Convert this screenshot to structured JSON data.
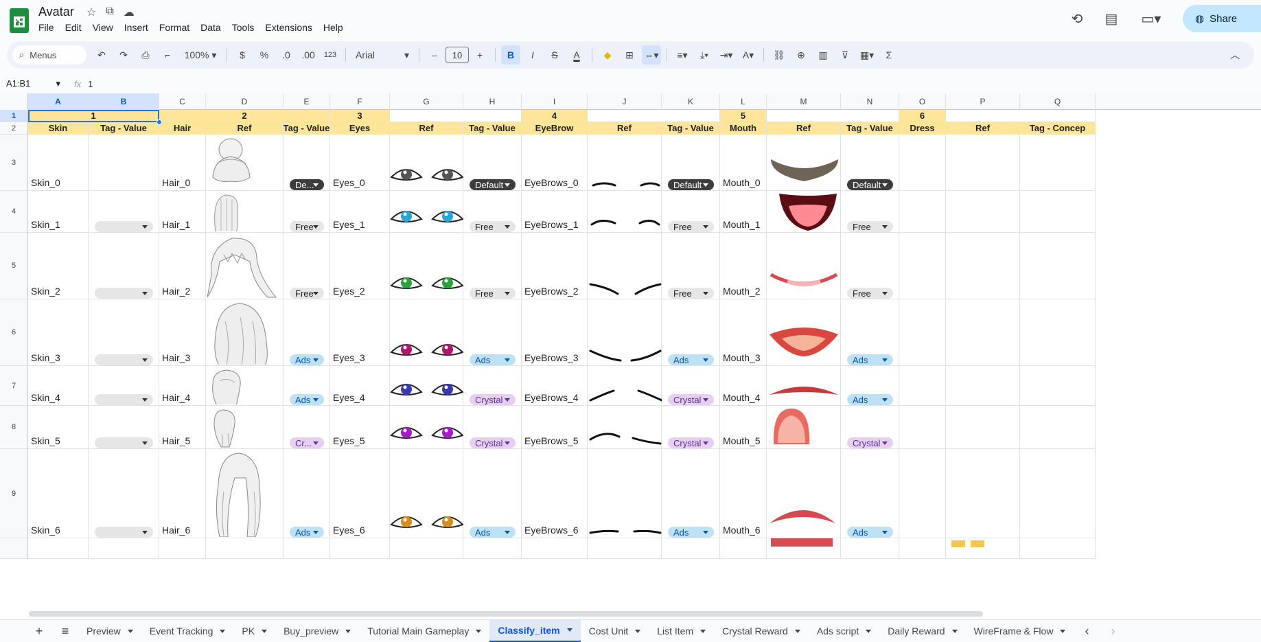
{
  "doc": {
    "title": "Avatar",
    "icons": [
      "star-icon",
      "move-to-folder-icon",
      "cloud-saved-icon"
    ]
  },
  "menu": [
    "File",
    "Edit",
    "View",
    "Insert",
    "Format",
    "Data",
    "Tools",
    "Extensions",
    "Help"
  ],
  "header_right": {
    "share_label": "Share",
    "icons": [
      "history-icon",
      "comment-icon",
      "meet-icon"
    ]
  },
  "toolbar": {
    "search_label": "Menus",
    "zoom": "100%",
    "currency": "$",
    "percent": "%",
    "dec_decrease": ".0",
    "dec_increase": ".00",
    "more_formats": "123",
    "font": "Arial",
    "font_size": "10",
    "minus": "–",
    "plus": "+",
    "bold": "B",
    "italic": "I",
    "strike": "S",
    "text_color": "A",
    "sigma": "Σ"
  },
  "formula": {
    "namebox": "A1:B1",
    "fx": "fx",
    "value": "1"
  },
  "columns": [
    "A",
    "B",
    "C",
    "D",
    "E",
    "F",
    "G",
    "H",
    "I",
    "J",
    "K",
    "L",
    "M",
    "N",
    "O",
    "P",
    "Q"
  ],
  "rows": [
    "1",
    "2",
    "3",
    "4",
    "5",
    "6",
    "7",
    "8",
    "9"
  ],
  "group_row": [
    "1",
    "2",
    "3",
    "4",
    "5",
    "6"
  ],
  "header_row": [
    "Skin",
    "Tag - Value",
    "Hair",
    "Ref",
    "Tag - Value",
    "Eyes",
    "Ref",
    "Tag - Value",
    "EyeBrow",
    "Ref",
    "Tag - Value",
    "Mouth",
    "Ref",
    "Tag - Value",
    "Dress",
    "Ref",
    "Tag - Concep"
  ],
  "items": [
    {
      "skin": "Skin_0",
      "hair": "Hair_0",
      "hair_tag": "De...",
      "eyes": "Eyes_0",
      "eyes_tag": "Default",
      "brow": "EyeBrows_0",
      "brow_tag": "Default",
      "mouth": "Mouth_0",
      "mouth_tag": "Default"
    },
    {
      "skin": "Skin_1",
      "hair": "Hair_1",
      "hair_tag": "Free",
      "eyes": "Eyes_1",
      "eyes_tag": "Free",
      "brow": "EyeBrows_1",
      "brow_tag": "Free",
      "mouth": "Mouth_1",
      "mouth_tag": "Free"
    },
    {
      "skin": "Skin_2",
      "hair": "Hair_2",
      "hair_tag": "Free",
      "eyes": "Eyes_2",
      "eyes_tag": "Free",
      "brow": "EyeBrows_2",
      "brow_tag": "Free",
      "mouth": "Mouth_2",
      "mouth_tag": "Free"
    },
    {
      "skin": "Skin_3",
      "hair": "Hair_3",
      "hair_tag": "Ads",
      "eyes": "Eyes_3",
      "eyes_tag": "Ads",
      "brow": "EyeBrows_3",
      "brow_tag": "Ads",
      "mouth": "Mouth_3",
      "mouth_tag": "Ads"
    },
    {
      "skin": "Skin_4",
      "hair": "Hair_4",
      "hair_tag": "Ads",
      "eyes": "Eyes_4",
      "eyes_tag": "Crystal",
      "brow": "EyeBrows_4",
      "brow_tag": "Crystal",
      "mouth": "Mouth_4",
      "mouth_tag": "Ads"
    },
    {
      "skin": "Skin_5",
      "hair": "Hair_5",
      "hair_tag": "Cr...",
      "eyes": "Eyes_5",
      "eyes_tag": "Crystal",
      "brow": "EyeBrows_5",
      "brow_tag": "Crystal",
      "mouth": "Mouth_5",
      "mouth_tag": "Crystal"
    },
    {
      "skin": "Skin_6",
      "hair": "Hair_6",
      "hair_tag": "Ads",
      "eyes": "Eyes_6",
      "eyes_tag": "Ads",
      "brow": "EyeBrows_6",
      "brow_tag": "Ads",
      "mouth": "Mouth_6",
      "mouth_tag": "Ads"
    }
  ],
  "sheets": [
    "Preview",
    "Event Tracking",
    "PK",
    "Buy_preview",
    "Tutorial Main Gameplay",
    "Classify_item",
    "Cost Unit",
    "List Item",
    "Crystal Reward",
    "Ads script",
    "Daily Reward",
    "WireFrame & Flow"
  ],
  "active_sheet": "Classify_item",
  "colors": {
    "header_fill": "#ffe599",
    "selection": "#1a73e8",
    "default_chip": "#3d3d3d",
    "free_chip": "#e6e6e6",
    "ads_chip": "#bfe1f6",
    "crystal_chip": "#e6cff2"
  }
}
